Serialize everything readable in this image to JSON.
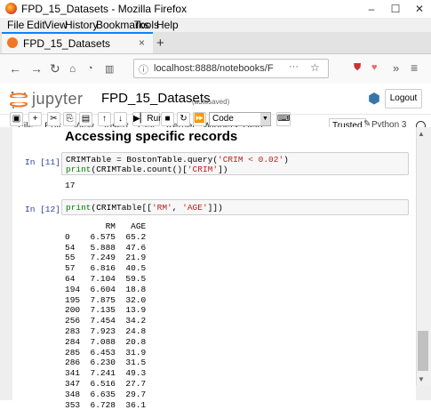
{
  "window": {
    "title": "FPD_15_Datasets - Mozilla Firefox",
    "controls": [
      "–",
      "☐",
      "✕"
    ]
  },
  "menubar": [
    "File",
    "Edit",
    "View",
    "History",
    "Bookmarks",
    "Tools",
    "Help"
  ],
  "tab": {
    "label": "FPD_15_Datasets",
    "close": "×",
    "new": "+"
  },
  "nav": {
    "url": "localhost:8888/notebooks/F",
    "dots": "···"
  },
  "jupyter": {
    "brand": "jupyter",
    "notebook_title": "FPD_15_Datasets",
    "autosave": "(autosaved)",
    "logout": "Logout",
    "menu": [
      "File",
      "Edit",
      "View",
      "Insert",
      "Cell",
      "Kernel",
      "Widgets",
      "Help"
    ],
    "trusted": "Trusted",
    "kernel": "Python 3",
    "toolbar": {
      "run": "Run",
      "cell_type": "Code"
    }
  },
  "cells": {
    "heading": "Accessing specific records",
    "c11": {
      "prompt": "In [11]:",
      "line1_a": "CRIMTable = BostonTable.query(",
      "line1_s": "'CRIM < 0.02'",
      "line1_b": ")",
      "line2_a": "print",
      "line2_b": "(CRIMTable.count()[",
      "line2_s": "'CRIM'",
      "line2_c": "])",
      "output": "17"
    },
    "c12": {
      "prompt": "In [12]:",
      "line1_a": "print",
      "line1_b": "(CRIMTable[[",
      "line1_s1": "'RM'",
      "line1_c": ", ",
      "line1_s2": "'AGE'",
      "line1_d": "]])",
      "output": "        RM   AGE\n0    6.575  65.2\n54   5.888  47.6\n55   7.249  21.9\n57   6.816  40.5\n64   7.104  59.5\n194  6.604  18.8\n195  7.875  32.0\n200  7.135  13.9\n256  7.454  34.2\n283  7.923  24.8\n284  7.088  20.8\n285  6.453  31.9\n286  6.230  31.5\n341  7.241  49.3\n347  6.516  27.7\n348  6.635  29.7\n353  6.728  36.1"
    }
  }
}
